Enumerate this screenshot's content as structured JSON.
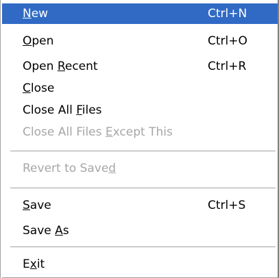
{
  "menu": {
    "items": [
      {
        "pre": "",
        "mn": "N",
        "post": "ew",
        "shortcut": "Ctrl+N",
        "state": "selected"
      },
      {
        "pre": "",
        "mn": "O",
        "post": "pen",
        "shortcut": "Ctrl+O",
        "state": "enabled"
      },
      {
        "pre": "Open ",
        "mn": "R",
        "post": "ecent",
        "shortcut": "Ctrl+R",
        "state": "enabled"
      },
      {
        "pre": "",
        "mn": "C",
        "post": "lose",
        "shortcut": "",
        "state": "enabled"
      },
      {
        "pre": "Close All ",
        "mn": "F",
        "post": "iles",
        "shortcut": "",
        "state": "enabled"
      },
      {
        "pre": "Close All Files ",
        "mn": "E",
        "post": "xcept This",
        "shortcut": "",
        "state": "disabled"
      },
      {
        "pre": "Revert to Save",
        "mn": "d",
        "post": "",
        "shortcut": "",
        "state": "disabled"
      },
      {
        "pre": "",
        "mn": "S",
        "post": "ave",
        "shortcut": "Ctrl+S",
        "state": "enabled"
      },
      {
        "pre": "Save ",
        "mn": "A",
        "post": "s",
        "shortcut": "",
        "state": "enabled"
      },
      {
        "pre": "E",
        "mn": "x",
        "post": "it",
        "shortcut": "",
        "state": "enabled"
      }
    ]
  },
  "colors": {
    "selection": "#316ac5",
    "disabled_text": "#a6a6a6"
  }
}
